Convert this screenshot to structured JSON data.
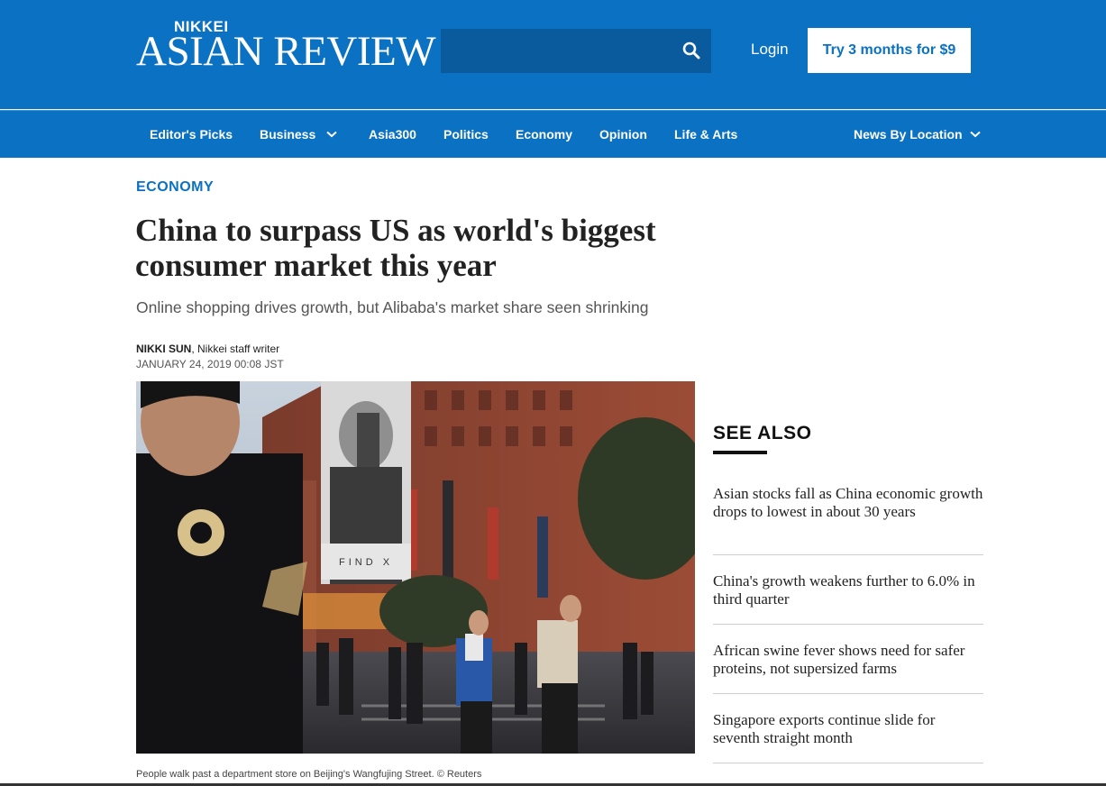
{
  "header": {
    "logo_small": "NIKKEI",
    "logo_big": "ASIAN REVIEW",
    "login_label": "Login",
    "trial_label": "Try 3 months for $9"
  },
  "nav": {
    "items": [
      "Editor's Picks",
      "Business",
      "Asia300",
      "Politics",
      "Economy",
      "Opinion",
      "Life & Arts"
    ],
    "right_label": "News By Location"
  },
  "article": {
    "section": "ECONOMY",
    "headline": "China to surpass US as world's biggest consumer market this year",
    "subhead": "Online shopping drives growth, but Alibaba's market share seen shrinking",
    "author": "NIKKI SUN",
    "author_role": ", Nikkei staff writer",
    "date": "JANUARY 24, 2019 00:08 JST",
    "caption": "People walk past a department store on Beijing's Wangfujing Street.    © Reuters",
    "photo_sign": "FIND X"
  },
  "see_also": {
    "title": "SEE ALSO",
    "items": [
      "Asian stocks fall as China economic growth drops to lowest in about 30 years",
      "China's growth weakens further to 6.0% in third quarter",
      "African swine fever shows need for safer proteins, not supersized farms",
      "Singapore exports continue slide for seventh straight month"
    ]
  },
  "colors": {
    "brand_blue": "#0b71c2",
    "search_blue": "#0a5b9e"
  },
  "icons": {
    "search": "search-icon",
    "chevron": "chevron-down-icon"
  }
}
